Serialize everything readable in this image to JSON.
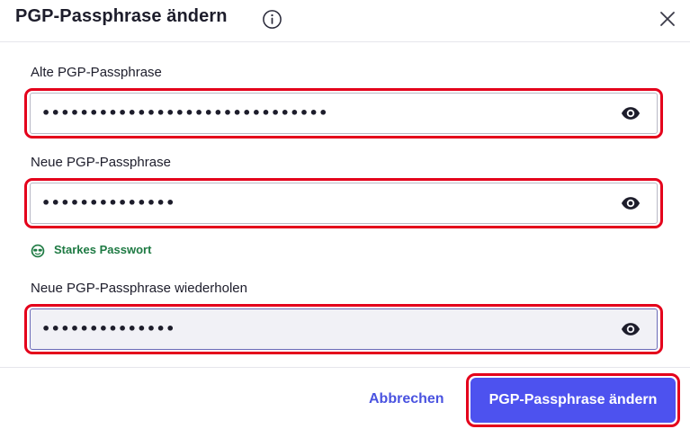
{
  "dialog": {
    "title": "PGP-Passphrase ändern",
    "info_icon": "info-circle-icon",
    "close_icon": "close-x-icon"
  },
  "fields": {
    "old": {
      "label": "Alte PGP-Passphrase",
      "value": "••••••••••••••••••••••••••••••",
      "icon": "eye-icon"
    },
    "new": {
      "label": "Neue PGP-Passphrase",
      "value": "••••••••••••••",
      "icon": "eye-icon"
    },
    "repeat": {
      "label": "Neue PGP-Passphrase wiederholen",
      "value": "••••••••••••••",
      "icon": "eye-icon"
    }
  },
  "strength": {
    "text": "Starkes Passwort",
    "icon": "strength-badge-icon",
    "color": "#1e7a43"
  },
  "footer": {
    "cancel_label": "Abbrechen",
    "submit_label": "PGP-Passphrase ändern"
  },
  "colors": {
    "accent": "#4d52ef",
    "highlight": "#e4001b"
  }
}
